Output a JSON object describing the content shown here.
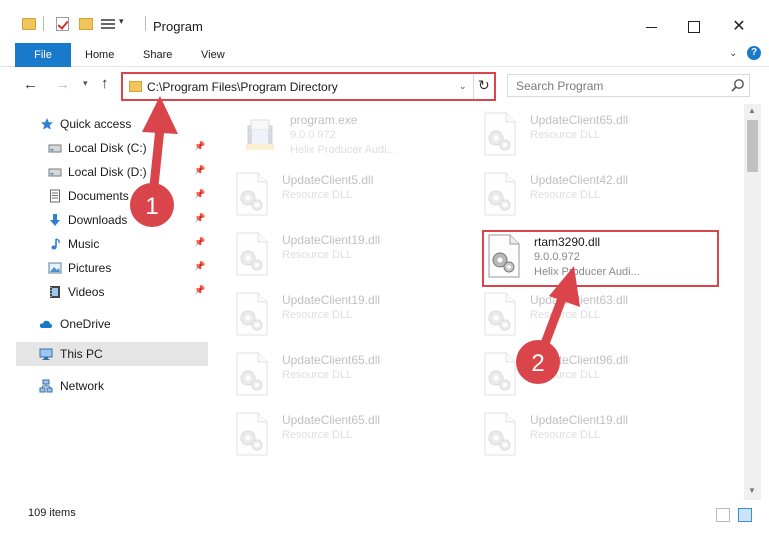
{
  "window": {
    "title": "Program",
    "minimize_label": "",
    "maximize_label": "",
    "close_label": "✕"
  },
  "ribbon": {
    "tabs": [
      {
        "label": "File"
      },
      {
        "label": "Home"
      },
      {
        "label": "Share"
      },
      {
        "label": "View"
      }
    ],
    "help_label": "?"
  },
  "address": {
    "path": "C:\\Program Files\\Program Directory"
  },
  "search": {
    "placeholder": "Search Program"
  },
  "navigation": {
    "items": [
      {
        "label": "Quick access",
        "icon": "star-icon",
        "pinned": false
      },
      {
        "label": "Local Disk (C:)",
        "icon": "drive-icon",
        "pinned": true
      },
      {
        "label": "Local Disk (D:)",
        "icon": "drive-icon",
        "pinned": true
      },
      {
        "label": "Documents",
        "icon": "documents-icon",
        "pinned": true
      },
      {
        "label": "Downloads",
        "icon": "downloads-icon",
        "pinned": true
      },
      {
        "label": "Music",
        "icon": "music-icon",
        "pinned": true
      },
      {
        "label": "Pictures",
        "icon": "pictures-icon",
        "pinned": true
      },
      {
        "label": "Videos",
        "icon": "videos-icon",
        "pinned": true
      },
      {
        "label": "OneDrive",
        "icon": "cloud-icon",
        "pinned": false
      },
      {
        "label": "This PC",
        "icon": "computer-icon",
        "pinned": false,
        "selected": true
      },
      {
        "label": "Network",
        "icon": "network-icon",
        "pinned": false
      }
    ]
  },
  "files": [
    {
      "name": "program.exe",
      "version": "9.0.0.972",
      "description": "Helix Producer Audi...",
      "type": "exe",
      "faded": true
    },
    {
      "name": "UpdateClient65.dll",
      "version": "Resource DLL",
      "description": "",
      "type": "dll",
      "faded": true
    },
    {
      "name": "UpdateClient5.dll",
      "version": "Resource DLL",
      "description": "",
      "type": "dll",
      "faded": true
    },
    {
      "name": "UpdateClient42.dll",
      "version": "Resource DLL",
      "description": "",
      "type": "dll",
      "faded": true
    },
    {
      "name": "UpdateClient19.dll",
      "version": "Resource DLL",
      "description": "",
      "type": "dll",
      "faded": true
    },
    {
      "name": "rtam3290.dll",
      "version": "9.0.0.972",
      "description": "Helix Producer Audi...",
      "type": "dll",
      "faded": false,
      "highlighted": true
    },
    {
      "name": "UpdateClient19.dll",
      "version": "Resource DLL",
      "description": "",
      "type": "dll",
      "faded": true
    },
    {
      "name": "UpdateClient63.dll",
      "version": "Resource DLL",
      "description": "",
      "type": "dll",
      "faded": true
    },
    {
      "name": "UpdateClient65.dll",
      "version": "Resource DLL",
      "description": "",
      "type": "dll",
      "faded": true
    },
    {
      "name": "UpdateClient96.dll",
      "version": "Resource DLL",
      "description": "",
      "type": "dll",
      "faded": true
    },
    {
      "name": "UpdateClient65.dll",
      "version": "Resource DLL",
      "description": "",
      "type": "dll",
      "faded": true
    },
    {
      "name": "UpdateClient19.dll",
      "version": "Resource DLL",
      "description": "",
      "type": "dll",
      "faded": true
    }
  ],
  "status": {
    "item_count": "109 items"
  },
  "annotations": {
    "badge_1": "1",
    "badge_2": "2",
    "color": "#d9454b"
  },
  "colors": {
    "accent": "#1979ca",
    "selection": "#e5e5e5",
    "folder": "#f2c55c"
  }
}
